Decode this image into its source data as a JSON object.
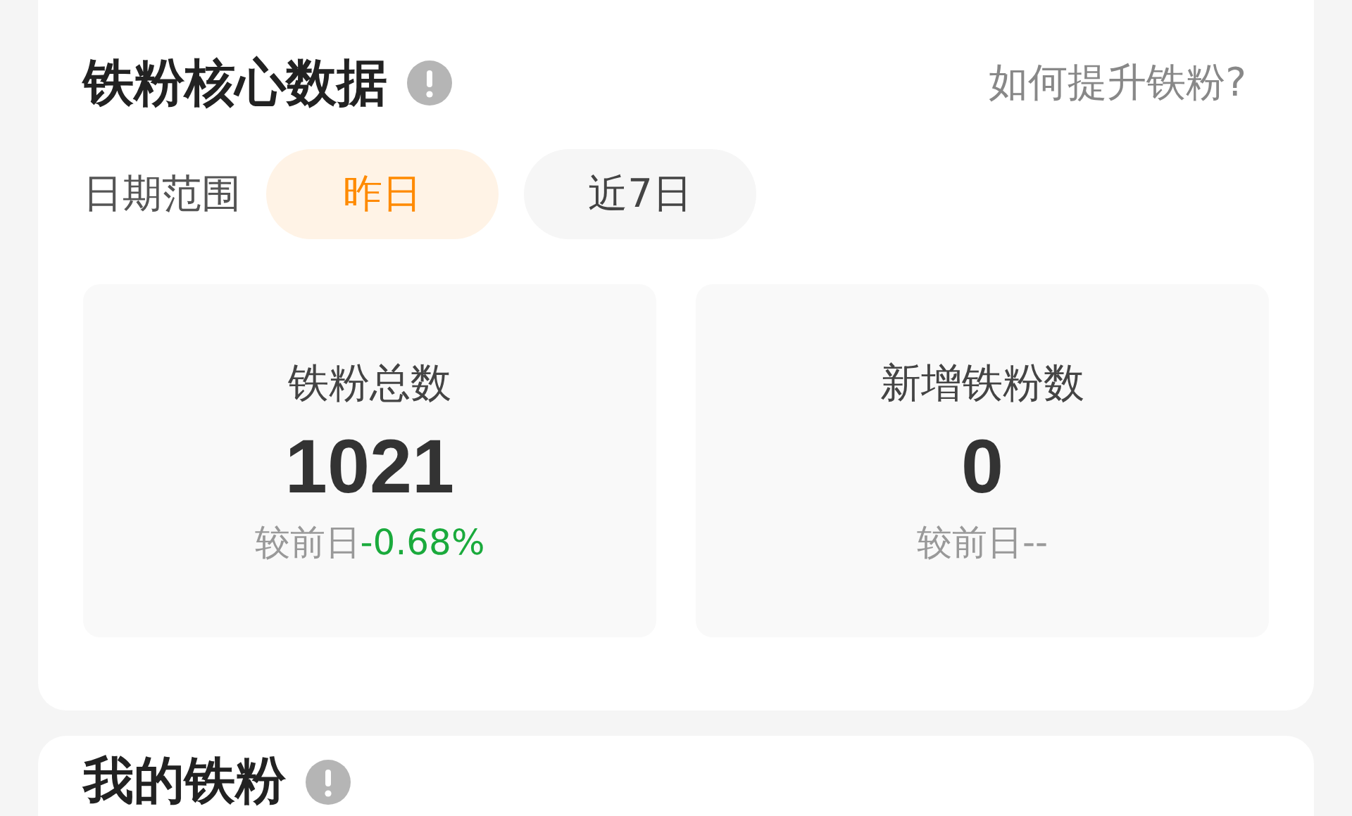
{
  "core_card": {
    "title": "铁粉核心数据",
    "help_link": "如何提升铁粉?"
  },
  "date_range": {
    "label": "日期范围",
    "options": [
      {
        "label": "昨日",
        "selected": true
      },
      {
        "label": "近7日",
        "selected": false
      }
    ]
  },
  "stats": [
    {
      "label": "铁粉总数",
      "value": "1021",
      "compare_label": "较前日",
      "change": "-0.68%",
      "kind": "decrease"
    },
    {
      "label": "新增铁粉数",
      "value": "0",
      "compare_label": "较前日",
      "change": "--",
      "kind": "neutral"
    }
  ],
  "next_card": {
    "title": "我的铁粉"
  }
}
